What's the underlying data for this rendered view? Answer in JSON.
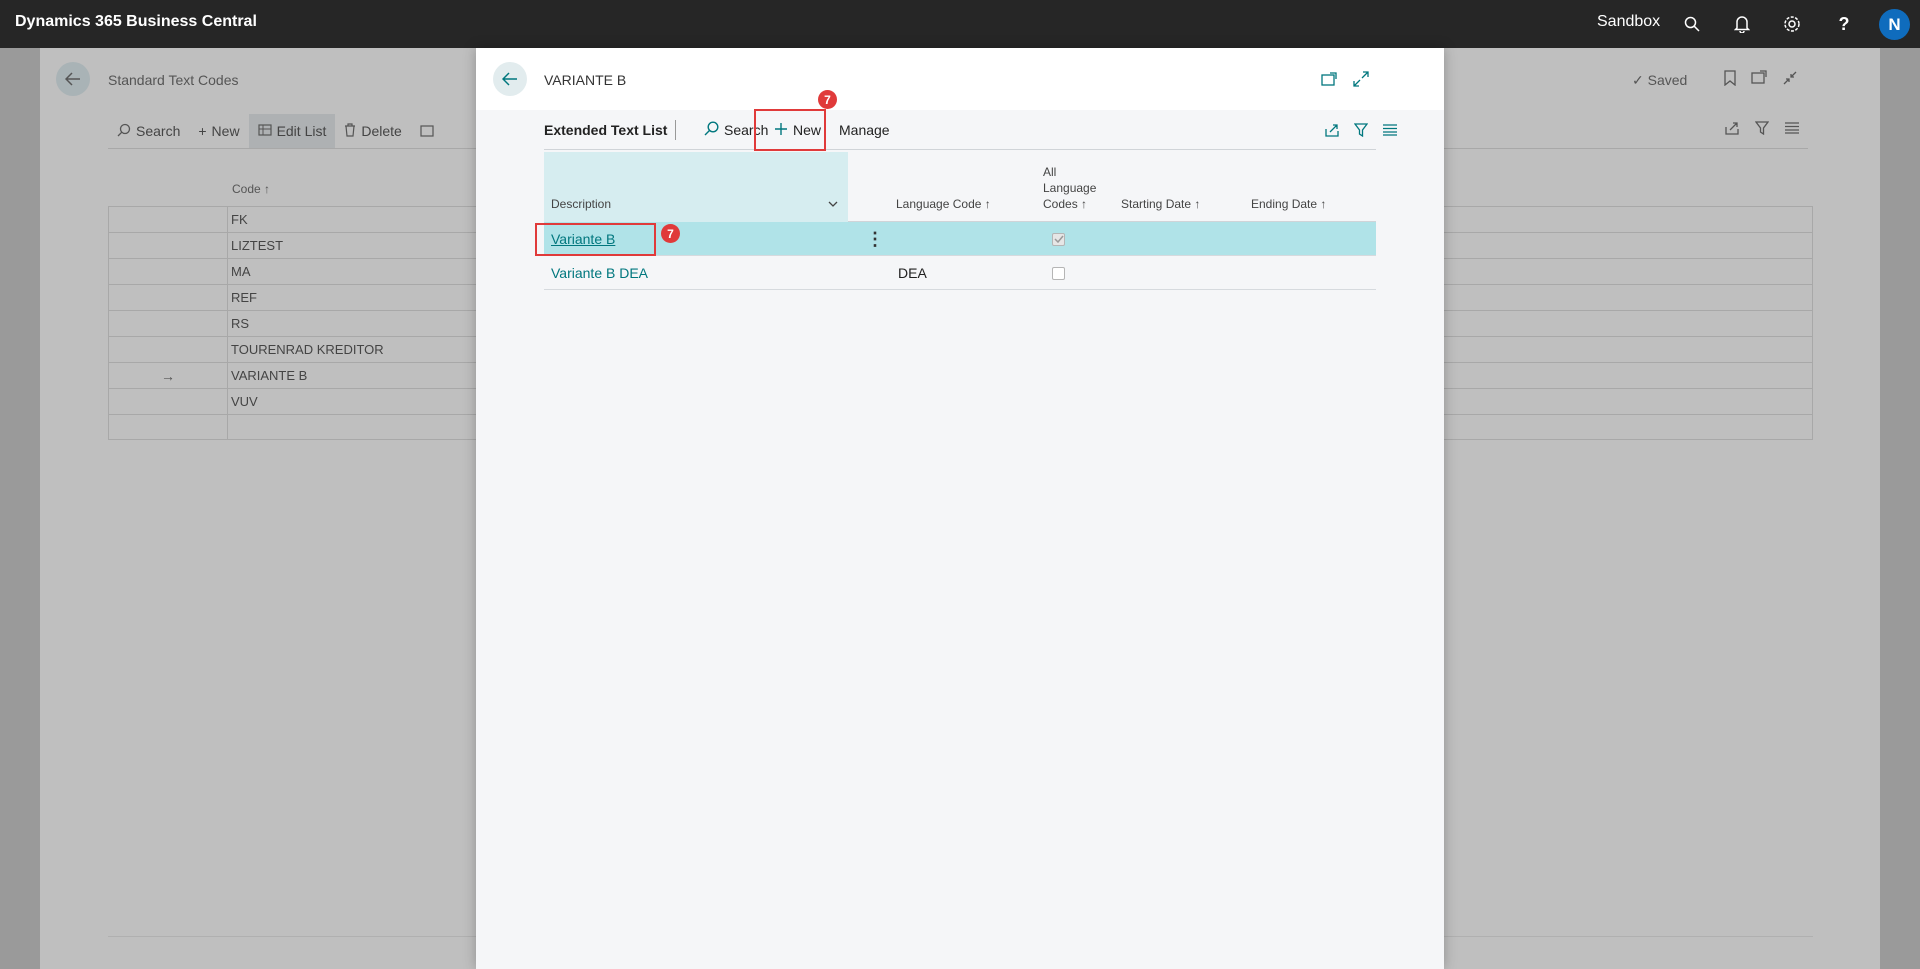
{
  "topbar": {
    "app_title": "Dynamics 365 Business Central",
    "environment": "Sandbox",
    "avatar_initial": "N"
  },
  "background_page": {
    "title": "Standard Text Codes",
    "saved_label": "Saved",
    "actions": [
      {
        "label": "Search",
        "icon": "search-icon"
      },
      {
        "label": "New",
        "icon": "plus-icon"
      },
      {
        "label": "Edit List",
        "icon": "edit-list-icon"
      },
      {
        "label": "Delete",
        "icon": "delete-icon"
      }
    ],
    "code_column_header": "Code",
    "rows": [
      {
        "code": "FK",
        "current": false
      },
      {
        "code": "LIZTEST",
        "current": false
      },
      {
        "code": "MA",
        "current": false
      },
      {
        "code": "REF",
        "current": false
      },
      {
        "code": "RS",
        "current": false
      },
      {
        "code": "TOURENRAD KREDITOR",
        "current": false
      },
      {
        "code": "VARIANTE B",
        "current": true,
        "row_marker": "→"
      },
      {
        "code": "VUV",
        "current": false
      },
      {
        "code": "",
        "current": false
      }
    ]
  },
  "modal": {
    "title": "VARIANTE B",
    "list_name": "Extended Text List",
    "actions": {
      "search": "Search",
      "new": "New",
      "manage": "Manage"
    },
    "step_badges": {
      "new_button": "7",
      "first_row": "7"
    },
    "columns": {
      "description": "Description",
      "language_code": "Language Code",
      "all_language_codes_line1": "All",
      "all_language_codes_line2": "Language",
      "all_language_codes_line3": "Codes",
      "starting_date": "Starting Date",
      "ending_date": "Ending Date",
      "sort_arrow": "↑"
    },
    "rows": [
      {
        "description": "Variante B",
        "language_code": "",
        "all_language_codes": true,
        "starting_date": "",
        "ending_date": "",
        "selected": true
      },
      {
        "description": "Variante B DEA",
        "language_code": "DEA",
        "all_language_codes": false,
        "starting_date": "",
        "ending_date": "",
        "selected": false
      }
    ]
  },
  "colors": {
    "topbar_bg": "#262626",
    "accent_teal": "#00777e",
    "selected_row": "#b0e3e8",
    "highlight_red": "#e03a3a",
    "avatar_blue": "#0f6cbd"
  }
}
